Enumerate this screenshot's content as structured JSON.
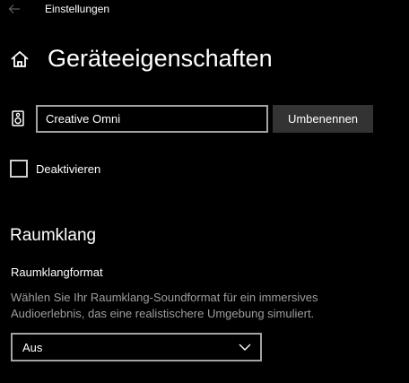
{
  "window": {
    "title": "Einstellungen",
    "back_icon": "back-arrow-icon"
  },
  "header": {
    "home_icon": "home-icon",
    "title": "Geräteeigenschaften"
  },
  "device": {
    "icon": "speaker-icon",
    "name_value": "Creative Omni",
    "rename_label": "Umbenennen"
  },
  "disable": {
    "label": "Deaktivieren",
    "checked": false
  },
  "spatial_sound": {
    "heading": "Raumklang",
    "format_label": "Raumklangformat",
    "description": "Wählen Sie Ihr Raumklang-Soundformat für ein immersives Audioerlebnis, das eine realistischere Umgebung simuliert.",
    "selected": "Aus",
    "chevron_icon": "chevron-down-icon"
  },
  "colors": {
    "background": "#000000",
    "text": "#ffffff",
    "secondary_text": "#9e9e9e",
    "button_bg": "#333333",
    "border": "#a3a3a3"
  }
}
